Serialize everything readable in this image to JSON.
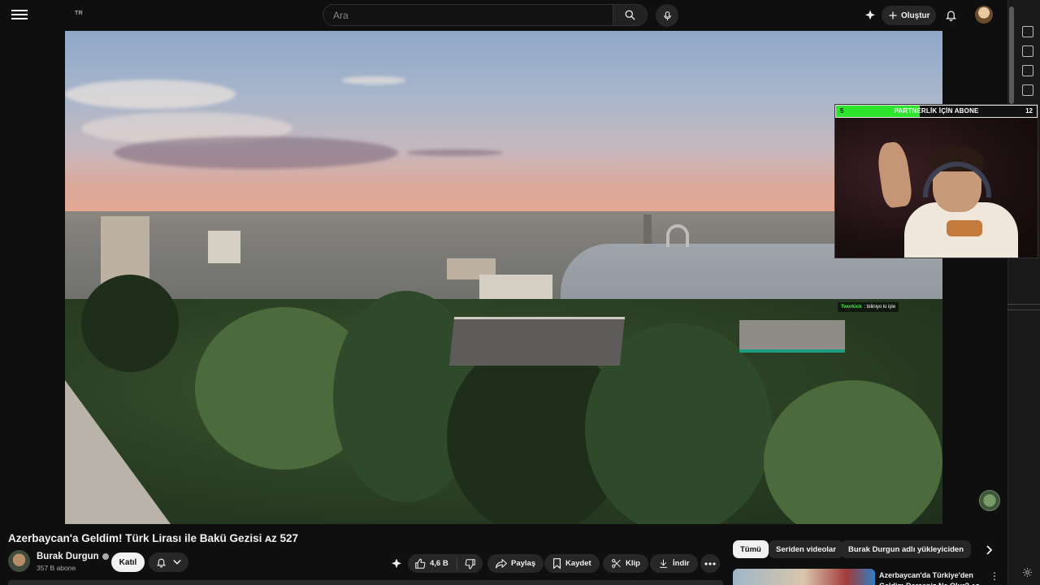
{
  "header": {
    "country_code": "TR",
    "search_placeholder": "Ara",
    "create_label": "Oluştur"
  },
  "video": {
    "title": "Azerbaycan'a Geldim! Türk Lirası ile Bakü Gezisi ᴀᴢ 527",
    "channel_name": "Burak Durgun",
    "subscribers": "357 B abone",
    "join_label": "Katıl",
    "likes": "4,6 B",
    "share_label": "Paylaş",
    "save_label": "Kaydet",
    "clip_label": "Klip",
    "download_label": "İndir"
  },
  "overlay": {
    "goal_label": "PARTNERLİK İÇİN ABONE",
    "goal_current": "5",
    "goal_target": "12",
    "chat_user": "Tworkick",
    "chat_message": ": biliniyo ki işte",
    "goal_color": "#2ee52e"
  },
  "chips": [
    "Tümü",
    "Seriden videolar",
    "Burak Durgun adlı yükleyiciden"
  ],
  "recommendation": {
    "title": "Azerbaycan'da Türkiye'den Geldim Derseniz Ne Olur? ᴀᴢ"
  },
  "icons": {
    "menu": "hamburger-icon",
    "search": "search-icon",
    "mic": "mic-icon",
    "ai": "sparkle-icon",
    "notifications": "bell-icon",
    "settings": "gear-icon"
  },
  "colors": {
    "background": "#0f0f0f",
    "pill": "#272727",
    "text": "#f1f1f1"
  }
}
